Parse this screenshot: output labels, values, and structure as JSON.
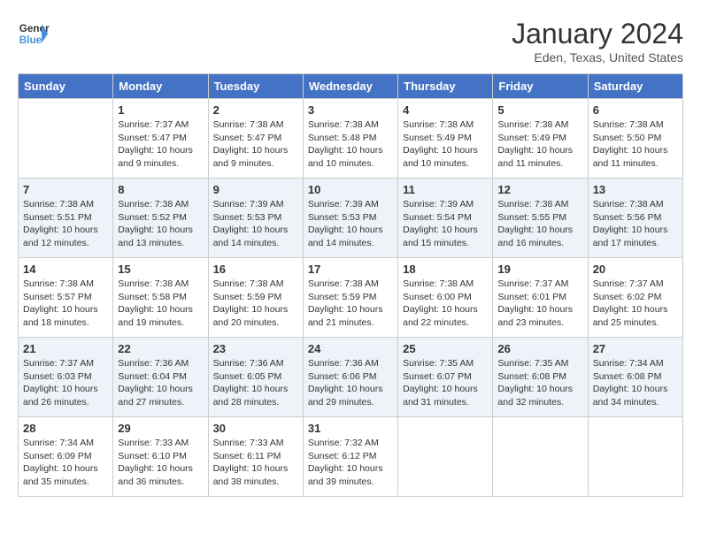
{
  "header": {
    "logo_line1": "General",
    "logo_line2": "Blue",
    "month_title": "January 2024",
    "location": "Eden, Texas, United States"
  },
  "columns": [
    "Sunday",
    "Monday",
    "Tuesday",
    "Wednesday",
    "Thursday",
    "Friday",
    "Saturday"
  ],
  "weeks": [
    {
      "days": [
        {
          "num": "",
          "info": ""
        },
        {
          "num": "1",
          "info": "Sunrise: 7:37 AM\nSunset: 5:47 PM\nDaylight: 10 hours\nand 9 minutes."
        },
        {
          "num": "2",
          "info": "Sunrise: 7:38 AM\nSunset: 5:47 PM\nDaylight: 10 hours\nand 9 minutes."
        },
        {
          "num": "3",
          "info": "Sunrise: 7:38 AM\nSunset: 5:48 PM\nDaylight: 10 hours\nand 10 minutes."
        },
        {
          "num": "4",
          "info": "Sunrise: 7:38 AM\nSunset: 5:49 PM\nDaylight: 10 hours\nand 10 minutes."
        },
        {
          "num": "5",
          "info": "Sunrise: 7:38 AM\nSunset: 5:49 PM\nDaylight: 10 hours\nand 11 minutes."
        },
        {
          "num": "6",
          "info": "Sunrise: 7:38 AM\nSunset: 5:50 PM\nDaylight: 10 hours\nand 11 minutes."
        }
      ]
    },
    {
      "days": [
        {
          "num": "7",
          "info": "Sunrise: 7:38 AM\nSunset: 5:51 PM\nDaylight: 10 hours\nand 12 minutes."
        },
        {
          "num": "8",
          "info": "Sunrise: 7:38 AM\nSunset: 5:52 PM\nDaylight: 10 hours\nand 13 minutes."
        },
        {
          "num": "9",
          "info": "Sunrise: 7:39 AM\nSunset: 5:53 PM\nDaylight: 10 hours\nand 14 minutes."
        },
        {
          "num": "10",
          "info": "Sunrise: 7:39 AM\nSunset: 5:53 PM\nDaylight: 10 hours\nand 14 minutes."
        },
        {
          "num": "11",
          "info": "Sunrise: 7:39 AM\nSunset: 5:54 PM\nDaylight: 10 hours\nand 15 minutes."
        },
        {
          "num": "12",
          "info": "Sunrise: 7:38 AM\nSunset: 5:55 PM\nDaylight: 10 hours\nand 16 minutes."
        },
        {
          "num": "13",
          "info": "Sunrise: 7:38 AM\nSunset: 5:56 PM\nDaylight: 10 hours\nand 17 minutes."
        }
      ]
    },
    {
      "days": [
        {
          "num": "14",
          "info": "Sunrise: 7:38 AM\nSunset: 5:57 PM\nDaylight: 10 hours\nand 18 minutes."
        },
        {
          "num": "15",
          "info": "Sunrise: 7:38 AM\nSunset: 5:58 PM\nDaylight: 10 hours\nand 19 minutes."
        },
        {
          "num": "16",
          "info": "Sunrise: 7:38 AM\nSunset: 5:59 PM\nDaylight: 10 hours\nand 20 minutes."
        },
        {
          "num": "17",
          "info": "Sunrise: 7:38 AM\nSunset: 5:59 PM\nDaylight: 10 hours\nand 21 minutes."
        },
        {
          "num": "18",
          "info": "Sunrise: 7:38 AM\nSunset: 6:00 PM\nDaylight: 10 hours\nand 22 minutes."
        },
        {
          "num": "19",
          "info": "Sunrise: 7:37 AM\nSunset: 6:01 PM\nDaylight: 10 hours\nand 23 minutes."
        },
        {
          "num": "20",
          "info": "Sunrise: 7:37 AM\nSunset: 6:02 PM\nDaylight: 10 hours\nand 25 minutes."
        }
      ]
    },
    {
      "days": [
        {
          "num": "21",
          "info": "Sunrise: 7:37 AM\nSunset: 6:03 PM\nDaylight: 10 hours\nand 26 minutes."
        },
        {
          "num": "22",
          "info": "Sunrise: 7:36 AM\nSunset: 6:04 PM\nDaylight: 10 hours\nand 27 minutes."
        },
        {
          "num": "23",
          "info": "Sunrise: 7:36 AM\nSunset: 6:05 PM\nDaylight: 10 hours\nand 28 minutes."
        },
        {
          "num": "24",
          "info": "Sunrise: 7:36 AM\nSunset: 6:06 PM\nDaylight: 10 hours\nand 29 minutes."
        },
        {
          "num": "25",
          "info": "Sunrise: 7:35 AM\nSunset: 6:07 PM\nDaylight: 10 hours\nand 31 minutes."
        },
        {
          "num": "26",
          "info": "Sunrise: 7:35 AM\nSunset: 6:08 PM\nDaylight: 10 hours\nand 32 minutes."
        },
        {
          "num": "27",
          "info": "Sunrise: 7:34 AM\nSunset: 6:08 PM\nDaylight: 10 hours\nand 34 minutes."
        }
      ]
    },
    {
      "days": [
        {
          "num": "28",
          "info": "Sunrise: 7:34 AM\nSunset: 6:09 PM\nDaylight: 10 hours\nand 35 minutes."
        },
        {
          "num": "29",
          "info": "Sunrise: 7:33 AM\nSunset: 6:10 PM\nDaylight: 10 hours\nand 36 minutes."
        },
        {
          "num": "30",
          "info": "Sunrise: 7:33 AM\nSunset: 6:11 PM\nDaylight: 10 hours\nand 38 minutes."
        },
        {
          "num": "31",
          "info": "Sunrise: 7:32 AM\nSunset: 6:12 PM\nDaylight: 10 hours\nand 39 minutes."
        },
        {
          "num": "",
          "info": ""
        },
        {
          "num": "",
          "info": ""
        },
        {
          "num": "",
          "info": ""
        }
      ]
    }
  ]
}
